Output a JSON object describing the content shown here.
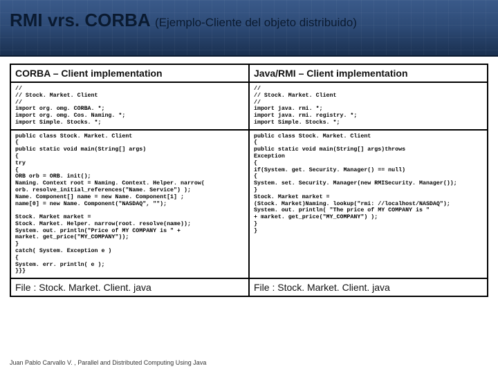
{
  "header": {
    "title_main": "RMI vrs. CORBA",
    "title_sub": "(Ejemplo-Cliente del objeto distribuido)"
  },
  "table": {
    "head_left": "CORBA – Client implementation",
    "head_right": "Java/RMI – Client implementation",
    "code_left_1": "//\n// Stock. Market. Client\n//\nimport org. omg. CORBA. *;\nimport org. omg. Cos. Naming. *;\nimport Simple. Stocks. *;",
    "code_right_1": "//\n// Stock. Market. Client\n//\nimport java. rmi. *;\nimport java. rmi. registry. *;\nimport Simple. Stocks. *;",
    "code_left_2": "public class Stock. Market. Client\n{\npublic static void main(String[] args)\n{\ntry\n{\nORB orb = ORB. init();\nNaming. Context root = Naming. Context. Helper. narrow(\norb. resolve_initial_references(\"Name. Service\") );\nName. Component[] name = new Name. Component[1] ;\nname[0] = new Name. Component(\"NASDAQ\", \"\");\n\nStock. Market market =\nStock. Market. Helper. narrow(root. resolve(name));\nSystem. out. println(\"Price of MY COMPANY is \" +\nmarket. get_price(\"MY_COMPANY\"));\n}\ncatch( System. Exception e )\n{\nSystem. err. println( e );\n}}}",
    "code_right_2": "public class Stock. Market. Client\n{\npublic static void main(String[] args)throws\nException\n{\nif(System. get. Security. Manager() == null)\n{\nSystem. set. Security. Manager(new RMISecurity. Manager());\n}\nStock. Market market =\n(Stock. Market)Naming. lookup(\"rmi: //localhost/NASDAQ\");\nSystem. out. println( \"The price of MY COMPANY is \"\n+ market. get_price(\"MY_COMPANY\") );\n}\n}",
    "file_left": "File : Stock. Market. Client. java",
    "file_right": "File : Stock. Market. Client. java"
  },
  "footer": "Juan Pablo Carvallo V. , Parallel and Distributed Computing Using Java"
}
